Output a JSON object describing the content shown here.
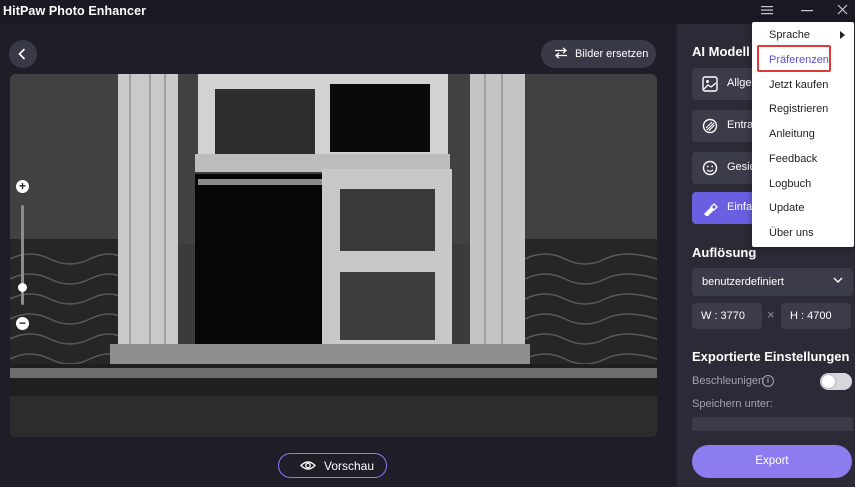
{
  "app": {
    "title": "HitPaw Photo Enhancer"
  },
  "window_controls": {
    "menu_icon": "hamburger-icon",
    "minimize_icon": "minimize-icon",
    "close_icon": "close-icon"
  },
  "toolbar": {
    "back_icon": "chevron-left-icon",
    "replace_label": "Bilder ersetzen",
    "replace_icon": "swap-arrows-icon"
  },
  "canvas": {
    "zoom_in_icon": "plus-icon",
    "zoom_out_icon": "minus-icon",
    "zoom_level": 0.22
  },
  "preview": {
    "label": "Vorschau",
    "icon": "eye-icon"
  },
  "panel": {
    "ai_model_title": "AI Modell",
    "models": [
      {
        "label": "Allge",
        "icon": "image-icon",
        "active": false
      },
      {
        "label": "Entra",
        "icon": "denoise-icon",
        "active": false
      },
      {
        "label": "Gesic",
        "icon": "face-icon",
        "active": false
      },
      {
        "label": "Einfa",
        "icon": "colorize-icon",
        "active": true
      }
    ],
    "resolution_title": "Auflösung",
    "resolution_select": "benutzerdefiniert",
    "width": "W : 3770",
    "height": "H : 4700",
    "dim_separator": "×",
    "export_title": "Exportierte Einstellungen",
    "accelerate_label": "Beschleunigen",
    "accelerate_on": false,
    "save_label": "Speichern unter:",
    "export_label": "Export"
  },
  "menu": {
    "items": [
      {
        "label": "Sprache",
        "submenu": true
      },
      {
        "label": "Präferenzen",
        "highlighted": true
      },
      {
        "label": "Jetzt kaufen"
      },
      {
        "label": "Registrieren"
      },
      {
        "label": "Anleitung"
      },
      {
        "label": "Feedback"
      },
      {
        "label": "Logbuch"
      },
      {
        "label": "Update"
      },
      {
        "label": "Über uns"
      }
    ]
  },
  "colors": {
    "accent": "#8b7cf0",
    "active_model": "#6a5fe0",
    "highlight_border": "#e03a36",
    "panel_bg": "#2b2a36",
    "app_bg": "#1f1e28"
  }
}
